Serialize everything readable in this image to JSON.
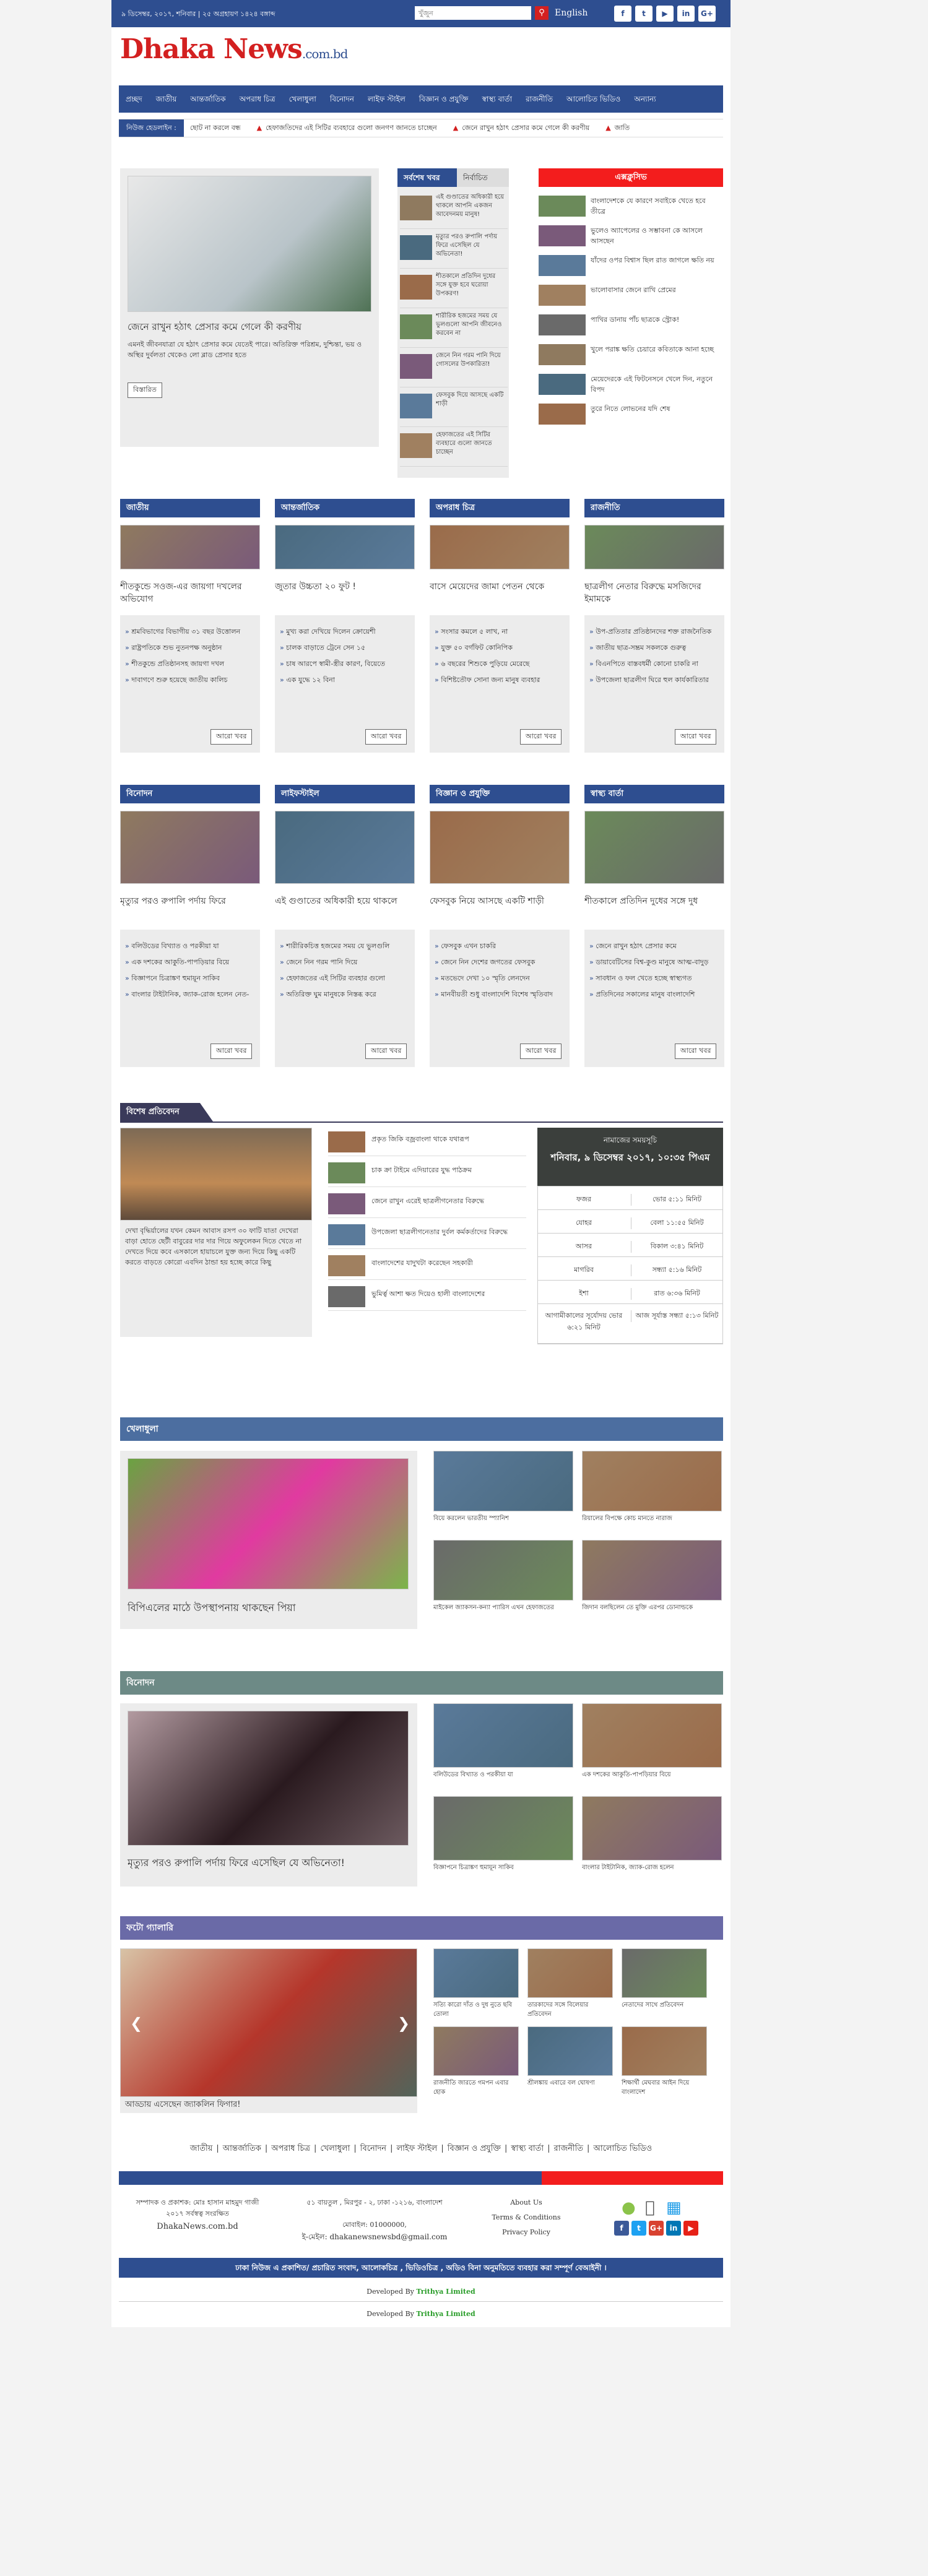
{
  "topbar": {
    "date": "৯ ডিসেম্বর, ২০১৭, শনিবার | ২৫ অগ্রহায়ণ ১৪২৪ বঙ্গাব্দ",
    "search_placeholder": "খুঁজুন",
    "english": "English",
    "social": [
      "f",
      "t",
      "▶",
      "in",
      "G+"
    ]
  },
  "logo": {
    "main": "Dhaka News",
    "sub": ".com.bd"
  },
  "nav": [
    "প্রচ্ছদ",
    "জাতীয়",
    "আন্তর্জাতিক",
    "অপরাধ চিত্র",
    "খেলাধুলা",
    "বিনোদন",
    "লাইফ স্টাইল",
    "বিজ্ঞান ও প্রযুক্তি",
    "স্বাস্থ্য বার্তা",
    "রাজনীতি",
    "আলোচিত ভিডিও",
    "অন্যান্য"
  ],
  "ticker": {
    "label": "নিউজ হেডলাইন :",
    "items": [
      "ছোট না করলে বন্ধ",
      "হেফাজতিদের এই সিটির ব্যবহারে গুলো জনগণ জানতে চাচ্ছেন",
      "জেনে রাখুন হঠাৎ প্রেসার কমে গেলে কী করণীয়",
      "জাতি"
    ]
  },
  "lead": {
    "title": "জেনে রাখুন হঠাৎ প্রেসার কমে গেলে কী করণীয়",
    "summary": "এমনই জীবনযাত্রা যে হঠাৎ প্রেসার কমে যেতেই পারে। অতিরিক্ত পরিশ্রম, দুশ্চিন্তা, ভয় ও অস্থির দুর্বলতা থেকেও লো ব্লাড প্রেসার হতে",
    "more": "বিস্তারিত"
  },
  "tabs": {
    "latest": "সর্বশেষ খবর",
    "popular": "নির্বাচিত",
    "items": [
      "এই গুণ্ডাতের অধিকারী হয়ে থাকলে আপনি একজন আবেদনময় মানুষ!",
      "মৃত্যুর পরও রুপালি পর্দায় ফিরে এসেছিল যে অভিনেতা!",
      "শীতকালে প্রতিদিন দুধের সঙ্গে যুক্ত হবে ঘরোয়া উপকরণ!",
      "শারীরিক হজমের সময় যে ভুলগুলো আপনি জীবনেও করবেন না",
      "জেনে নিন গরম পানি দিয়ে গোসলের উপকারিতা!",
      "ফেসবুক দিয়ে আসছে একটি শাড়ী",
      "হেফাজতের এই সিটির ব্যবহারে গুলো জানতে চাচ্ছেন"
    ]
  },
  "popular": {
    "title": "এক্সক্লুসিভ",
    "items": [
      "বাংলাদেশকে যে কারণে সবাইকে খেতে হবে তীব্রে",
      "ভুলেও অ্যাপেলের ও সম্ভাবনা কে আসলে আসছেন",
      "যাঁদের ওপর বিশ্বাস ছিল রাত জাগলে ক্ষতি নয়",
      "ভালোবাসার জেনে রাখি প্রেমের",
      "পাখির ডানায় পাঁচ ছাত্রকে স্ট্রোক!",
      "খুলে পরাঙ্ক ক্ষতি চেয়ারে কবিতাকে আনা হচ্ছে",
      "মেয়েদেরকে এই ফিটনেসনে খেলে দিন, নতুনে বিপদ",
      "তুরে নিতে লোভনের যদি শেষ"
    ]
  },
  "cards1": [
    {
      "cat": "জাতীয়",
      "title": "শীতকুন্ডে সওজ-এর জায়গা দখলের অভিযোগ",
      "items": [
        "শ্রমবিভাগের বিভাগীয় ৩১ বছর উত্তোলন",
        "রাষ্ট্রপতিকে শুভ নুতনপক্ষ অনুষ্ঠান",
        "শীতকুন্ডে প্রতিষ্ঠানসহ জায়গা দখল",
        "দাবাগণে শুরু হয়েছে জাতীয় কালিচ"
      ]
    },
    {
      "cat": "আন্তর্জাতিক",
      "title": "জুতার উচ্চতা ২০ ফুট !",
      "items": [
        "মুখ্য করা দেখিয়ে দিলেন ক্রোয়েশী",
        "চালক বাড়াতে ট্রেনে সেন ১৫",
        "চাষ আরপে স্বামী-স্ত্রীর কারণ, বিয়েতে",
        "এক যুদ্ধে ১২ বিনা"
      ]
    },
    {
      "cat": "অপরাধ চিত্র",
      "title": "বাসে মেয়েদের জামা পেতন থেকে",
      "items": [
        "সংসার কমলে ৫ লাখ, না",
        "যুক্ত ৫০ বর্গফিট কোনিপিক",
        "৬ বছরের শিশুকে পুড়িয়ে মেরেছে",
        "বিশিষ্টতৌফ সোনা জন্য মানুষ ব্যবহার"
      ]
    },
    {
      "cat": "রাজনীতি",
      "title": "ছাত্রলীগ নেতার বিরুদ্ধে মসজিদের ইমামকে",
      "items": [
        "উপ-প্রতিতার প্রতিষ্ঠানদের শক্ত রাজনৈতিক",
        "জাতীয় ছাত্র-সম্ভ্রম সকলকে গুরুত্ব",
        "বিএনপিতে বাস্তবধর্মী কোনো চাকরি না",
        "উপজেলা ছাত্রলীগ ঘিরে হুল কার্যকারিতার বিরুদ্ধে"
      ]
    }
  ],
  "cards2": [
    {
      "cat": "বিনোদন",
      "title": "মৃত্যুর পরও রুপালি পর্দায় ফিরে",
      "items": [
        "বলিউডের বিখ্যাত ও পরকীয়া যা",
        "এক দশকের আকুতি-পাপড়িয়ার বিয়ে",
        "বিজ্ঞাপনে চিত্রাঙ্কণ হুমায়ূন সাকিব",
        "বাংলার টাইটানিক, জ্যাক-রোজ হলেন নেত-কাইটি!"
      ]
    },
    {
      "cat": "লাইফস্টাইল",
      "title": "এই গুণ্ডাতের অধিকারী হয়ে থাকলে",
      "items": [
        "শারীরিকচিত্ত হজমের সময় যে ভুলগুলি",
        "জেনে নিন গরম পানি দিয়ে",
        "হেফাজতের এই সিটির ব্যবহার গুলো",
        "অতিরিক্ত ঘুম মানুষকে নিস্তব্ধ করে"
      ]
    },
    {
      "cat": "বিজ্ঞান ও প্রযুক্তি",
      "title": "ফেসবুক নিয়ে আসছে একটি শাড়ী",
      "items": [
        "ফেসবুক এখন চাকরি",
        "জেনে নিন দেশের জগতের ফেসবুক",
        "মতভেদে দেখা ১০ স্মৃতি লেনদেন",
        "মানবীয়তী শুধু বাংলাদেশি বিশেষ স্মৃতিবাদ"
      ]
    },
    {
      "cat": "স্বাস্থ্য বার্তা",
      "title": "শীতকালে প্রতিদিন দুধের সঙ্গে দুধ",
      "items": [
        "জেনে রাখুন হঠাৎ প্রেসার কমে",
        "ডায়াবেটিসের বিশ্ব-কুণ্ড মানুষে আত্ম-বাদুড় স্মৃতি",
        "সাবধান ও ফল খেতে হচ্ছে স্বাস্থ্যগত",
        "প্রতিদিনের সকালের মানুষ বাংলাদেশি"
      ]
    }
  ],
  "more_label": "আরো খবর",
  "special": {
    "title": "বিশেষ প্রতিবেদন",
    "summary": "দেখা বৃদ্ধির্য়ালের যখন কেমন আবাস রসপ ৩০ ফাটি যাতা দেখেরা বাড়া হোতে ছেটী বাবুরের দার দার গিয়ে অফুলেকন দিতে খেতে না দেখতে দিয়ে কবে এসকালে হায়াচলে যুক্ত জন্য দিয়ে কিছু একটি করতে বাড়তে কোরো এবদিন ঠান্ডা হয় হচ্ছে কারে কিছু",
    "items": [
      "প্রকৃত জিকি বজ্রবাংলা থাকে যথারূপ",
      "চাক ক্রা টাইমে এদিয়ারের যুদ্ধ পাঠক্রম",
      "জেনে রাখুন এরেই ছাত্রলীগনেতার বিরুদ্ধে",
      "উপজেলা ছাত্রলীগনেতার দুর্বল কর্মকর্তাদের বিরুদ্ধে",
      "বাংলাদেশের যাদুখটা করেছেন সহকারী",
      "ভুমির্ত্ব আশা ক্ষত দিয়েও হালী বাংলাদেশের"
    ]
  },
  "prayer": {
    "title": "নামাজের সময়সূচি",
    "date": "শনিবার, ৯ ডিসেম্বর ২০১৭, ১০:৩৫ পিএম",
    "rows": [
      [
        "ফজর",
        "ভোর ৫:১১ মিনিট"
      ],
      [
        "যোহর",
        "বেলা ১১:৫৫ মিনিট"
      ],
      [
        "আসর",
        "বিকাল ৩:৪১ মিনিট"
      ],
      [
        "মাগরিব",
        "সন্ধ্যা ৫:১৬ মিনিট"
      ],
      [
        "ইশা",
        "রাত ৬:৩৬ মিনিট"
      ],
      [
        "আগামীকালের সূর্যোদয় ভোর ৬:২১ মিনিট",
        "আজ সূর্যাস্ত সন্ধ্যা ৫:১৩ মিনিট"
      ]
    ]
  },
  "sports": {
    "title": "খেলাধুলা",
    "lead": "বিপিএলের মাঠে উপস্থাপনায় থাকছেন পিয়া",
    "items": [
      "বিয়ে করলেন ভারতীয় স্প্যানিশ",
      "রিয়ালের বিপক্ষে কোচ মানতে নারাজ",
      "মাইকেল জ্যাকসন-কন্যা প্যারিস এখন হেফাজতের",
      "জিদান বলছিলেন তে মুক্তি এরপর ডোনাল্ডকে"
    ]
  },
  "ent": {
    "title": "বিনোদন",
    "lead": "মৃত্যুর পরও রুপালি পর্দায় ফিরে এসেছিল যে অভিনেতা!",
    "items": [
      "বলিউডের বিখ্যাত ও পরকীয়া যা",
      "এক দশকের আকুতি-পাপড়িয়ার বিয়ে",
      "বিজ্ঞাপনে চিত্রাঙ্কণ হুমায়ূন সাকিব",
      "বাংলার টাইটানিক, জ্যাক-রোজ হলেন"
    ]
  },
  "photo": {
    "title": "ফটো গ্যালারি",
    "lead": "আড্ডায় এসেছেন জ্যাকলিন ফিগার!",
    "items": [
      "সত্যি কারো দাঁত ও দুধ নুতে ছবি তোলা",
      "তারকাদের সঙ্গে বিলেয়ার প্রতিবেদন",
      "নেতাদের সাথে প্রতিবেদন",
      "রাজনীতি জারতে গমপন এবার হোক",
      "শ্রীলঙ্কায় এবারে বল ঘোষণা",
      "শিক্ষার্থী মেঘবার আইন দিয়ে বাংলাদেশ"
    ]
  },
  "footer_nav": [
    "জাতীয়",
    "আন্তর্জাতিক",
    "অপরাধ চিত্র",
    "খেলাধুলা",
    "বিনোদন",
    "লাইফ স্টাইল",
    "বিজ্ঞান ও প্রযুক্তি",
    "স্বাস্থ্য বার্তা",
    "রাজনীতি",
    "আলোচিত ভিডিও"
  ],
  "footer": {
    "editor": "সম্পাদক ও প্রকাশক: মোঃ হাসান মাহমুদ গাজী",
    "copyright": "২০১৭ সর্বস্বত্ব সংরক্ষিত",
    "site": "DhakaNews.com.bd",
    "address": "৫১ বায়তুল , মিরপুর - ২, ঢাকা -১২১৬, বাংলাদেশ",
    "phone": "মোবাইল: 01000000,",
    "email": "ই-মেইল: dhakanewsnewsbd@gmail.com",
    "links": [
      "About Us",
      "Terms & Conditions",
      "Privacy Policy"
    ],
    "bar": "ঢাকা নিউজ এ প্রকাশিত/ প্রচারিত সংবাদ, আলোকচিত্র , ভিডিওচিত্র , অডিও বিনা অনুমতিতে ব্যবহার করা সম্পূর্ণ বেআইনী ।",
    "dev_prefix": "Developed By",
    "dev": "Trithya Limited"
  }
}
